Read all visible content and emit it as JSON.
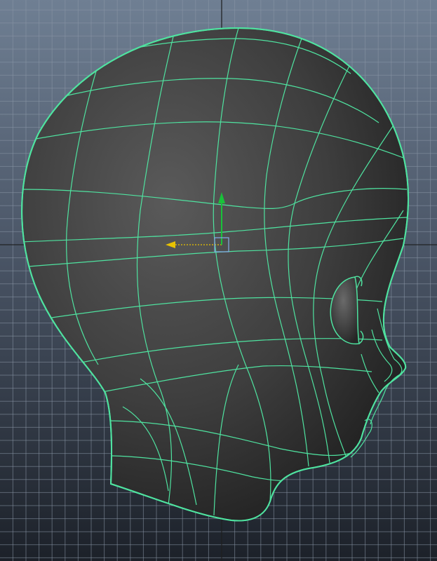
{
  "viewport": {
    "view": "side",
    "colors": {
      "bg_top": "#6f7f93",
      "bg_bottom": "#1c2129",
      "grid_line": "#8a96a6",
      "grid_axis": "#1a1a1a",
      "wireframe": "#4fe3a0",
      "surface_light": "#5a5a5a",
      "surface_dark": "#1e1e1e",
      "manip_x": "#e8c200",
      "manip_y": "#19c23a",
      "manip_center": "#7fa7e0"
    }
  },
  "objects": [
    {
      "name": "head-mesh",
      "type": "polygon-mesh",
      "display": "shaded-wireframe",
      "selected": true
    }
  ],
  "manipulator": {
    "tool": "move",
    "visible_axes": [
      "x",
      "y"
    ]
  }
}
